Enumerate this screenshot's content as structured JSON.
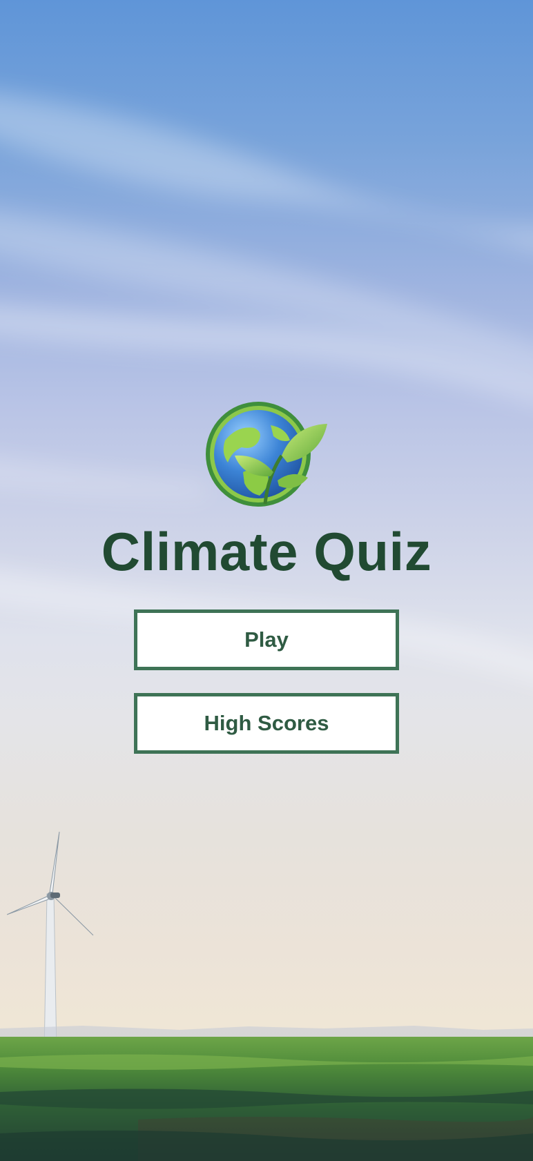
{
  "app": {
    "title": "Climate Quiz",
    "logo_icon": "earth-sprout-icon",
    "background": "sky-wind-turbine-landscape"
  },
  "menu": {
    "play_label": "Play",
    "high_scores_label": "High Scores"
  },
  "colors": {
    "title": "#214a32",
    "button_border": "#3e7356",
    "button_text": "#2f5b43",
    "button_bg": "#ffffff"
  }
}
